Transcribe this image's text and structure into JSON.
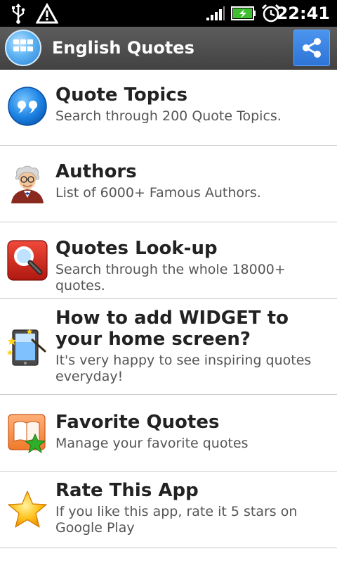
{
  "status_bar": {
    "time": "22:41",
    "icons": [
      "usb-icon",
      "warning-icon",
      "signal-icon",
      "battery-charging-icon",
      "alarm-clock-icon"
    ]
  },
  "action_bar": {
    "title": "English Quotes",
    "app_icon": "grid-icon",
    "share_icon": "share-icon"
  },
  "menu": {
    "items": [
      {
        "title": "Quote Topics",
        "subtitle": "Search through 200 Quote Topics.",
        "icon": "quote-bubble-icon"
      },
      {
        "title": "Authors",
        "subtitle": "List of 6000+ Famous Authors.",
        "icon": "author-avatar-icon"
      },
      {
        "title": "Quotes Look-up",
        "subtitle": "Search through the whole 18000+ quotes.",
        "icon": "magnifier-icon"
      },
      {
        "title": "How to add WIDGET to your home screen?",
        "subtitle": "It's very happy to see inspiring quotes everyday!",
        "icon": "widget-tablet-icon"
      },
      {
        "title": "Favorite Quotes",
        "subtitle": "Manage your favorite quotes",
        "icon": "favorite-book-icon"
      },
      {
        "title": "Rate This App",
        "subtitle": "If you like this app, rate it 5 stars on Google Play",
        "icon": "star-icon"
      }
    ]
  },
  "colors": {
    "status_bar_bg": "#000000",
    "action_bar_bg": "#4f4f4f",
    "share_button_bg": "#3a86e6",
    "list_bg": "#ffffff",
    "divider": "#c9c9c9",
    "title_text": "#222222",
    "subtitle_text": "#555555"
  }
}
